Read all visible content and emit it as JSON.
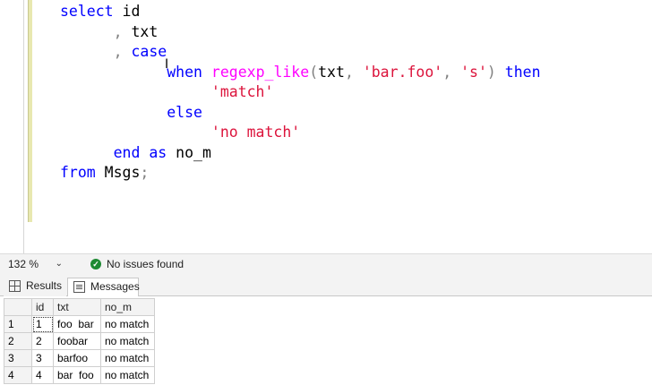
{
  "editor": {
    "lines": [
      [
        {
          "t": "select",
          "c": "kw"
        },
        {
          "t": " id",
          "c": ""
        }
      ],
      [
        {
          "t": "      , ",
          "c": "gray"
        },
        {
          "t": "txt",
          "c": ""
        }
      ],
      [
        {
          "t": "      , ",
          "c": "gray"
        },
        {
          "t": "case",
          "c": "kw"
        }
      ],
      [
        {
          "t": "            ",
          "c": ""
        },
        {
          "t": "when",
          "c": "kw"
        },
        {
          "t": " ",
          "c": ""
        },
        {
          "t": "regexp_like",
          "c": "fn"
        },
        {
          "t": "(",
          "c": "gray"
        },
        {
          "t": "txt",
          "c": ""
        },
        {
          "t": ", ",
          "c": "gray"
        },
        {
          "t": "'bar.foo'",
          "c": "str"
        },
        {
          "t": ", ",
          "c": "gray"
        },
        {
          "t": "'s'",
          "c": "str"
        },
        {
          "t": ") ",
          "c": "gray"
        },
        {
          "t": "then",
          "c": "kw"
        }
      ],
      [
        {
          "t": "                 ",
          "c": ""
        },
        {
          "t": "'match'",
          "c": "str"
        }
      ],
      [
        {
          "t": "            ",
          "c": ""
        },
        {
          "t": "else",
          "c": "kw"
        }
      ],
      [
        {
          "t": "                 ",
          "c": ""
        },
        {
          "t": "'no match'",
          "c": "str"
        }
      ],
      [
        {
          "t": "      ",
          "c": ""
        },
        {
          "t": "end",
          "c": "kw"
        },
        {
          "t": " ",
          "c": ""
        },
        {
          "t": "as",
          "c": "kw"
        },
        {
          "t": " no_m",
          "c": ""
        }
      ],
      [
        {
          "t": "from",
          "c": "kw"
        },
        {
          "t": " Msgs",
          "c": ""
        },
        {
          "t": ";",
          "c": "gray"
        }
      ]
    ]
  },
  "status": {
    "zoom": "132 %",
    "issues": "No issues found",
    "zoom_icon": "chevron-down-icon",
    "issues_icon": "check-circle-icon"
  },
  "tabs": {
    "results": "Results",
    "messages": "Messages"
  },
  "grid": {
    "columns": [
      "id",
      "txt",
      "no_m"
    ],
    "rows": [
      {
        "num": "1",
        "id": "1",
        "txt": "foo  bar",
        "no_m": "no match"
      },
      {
        "num": "2",
        "id": "2",
        "txt": "foobar",
        "no_m": "no match"
      },
      {
        "num": "3",
        "id": "3",
        "txt": "barfoo",
        "no_m": "no match"
      },
      {
        "num": "4",
        "id": "4",
        "txt": "bar  foo",
        "no_m": "no match"
      }
    ]
  },
  "colors": {
    "keyword": "#0000ff",
    "string": "#dc143c",
    "function": "#ff00ff",
    "success": "#1e8a33"
  }
}
